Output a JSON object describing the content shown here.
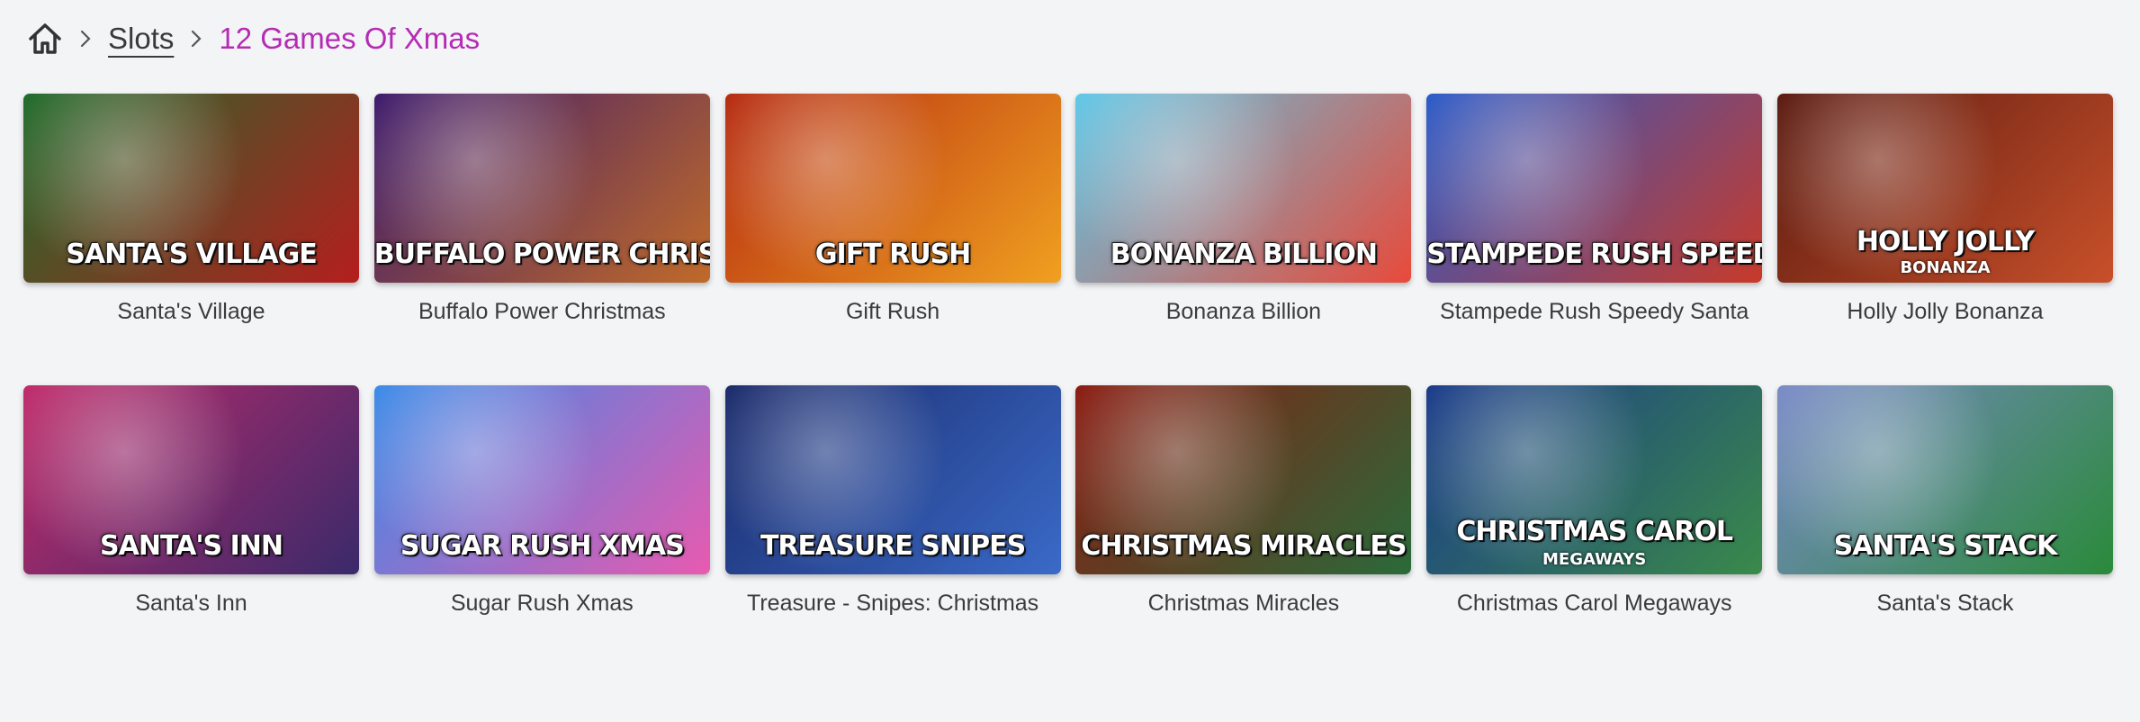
{
  "breadcrumb": {
    "home_icon": "home-icon",
    "items": [
      {
        "label": "Slots"
      },
      {
        "label": "12 Games Of Xmas"
      }
    ],
    "colors": {
      "current": "#b52bb5"
    }
  },
  "games": [
    {
      "title": "Santa's Village",
      "logo": "SANTA'S VILLAGE",
      "logo_sub": "",
      "bg": [
        "#1e6b2a",
        "#b51e1e"
      ]
    },
    {
      "title": "Buffalo Power Christmas",
      "logo": "BUFFALO POWER CHRISTMAS",
      "logo_sub": "",
      "bg": [
        "#3c1a6b",
        "#c06a2a"
      ]
    },
    {
      "title": "Gift Rush",
      "logo": "GIFT RUSH",
      "logo_sub": "",
      "bg": [
        "#b52a10",
        "#f0a020"
      ]
    },
    {
      "title": "Bonanza Billion",
      "logo": "BONANZA BILLION",
      "logo_sub": "",
      "bg": [
        "#5ec8e8",
        "#e84a3a"
      ]
    },
    {
      "title": "Stampede Rush Speedy Santa",
      "logo": "STAMPEDE RUSH SPEEDY SANTA",
      "logo_sub": "",
      "bg": [
        "#2a5ac8",
        "#c83a2a"
      ]
    },
    {
      "title": "Holly Jolly Bonanza",
      "logo": "HOLLY JOLLY",
      "logo_sub": "BONANZA",
      "bg": [
        "#5a1a10",
        "#c8502a"
      ]
    },
    {
      "title": "Santa's Inn",
      "logo": "SANTA'S INN",
      "logo_sub": "",
      "bg": [
        "#c02a6a",
        "#3a2a6a"
      ]
    },
    {
      "title": "Sugar Rush Xmas",
      "logo": "SUGAR RUSH XMAS",
      "logo_sub": "",
      "bg": [
        "#3a8ae8",
        "#e85ab0"
      ]
    },
    {
      "title": "Treasure - Snipes: Christmas",
      "logo": "TREASURE SNIPES",
      "logo_sub": "",
      "bg": [
        "#1a2a6a",
        "#3a6ac8"
      ]
    },
    {
      "title": "Christmas Miracles",
      "logo": "CHRISTMAS MIRACLES",
      "logo_sub": "",
      "bg": [
        "#8a1a10",
        "#2a6a3a"
      ]
    },
    {
      "title": "Christmas Carol Megaways",
      "logo": "CHRISTMAS CAROL",
      "logo_sub": "MEGAWAYS",
      "bg": [
        "#1a3a8a",
        "#3a8a4a"
      ]
    },
    {
      "title": "Santa's Stack",
      "logo": "SANTA'S STACK",
      "logo_sub": "",
      "bg": [
        "#7a8ac8",
        "#2a8a3a"
      ]
    }
  ]
}
